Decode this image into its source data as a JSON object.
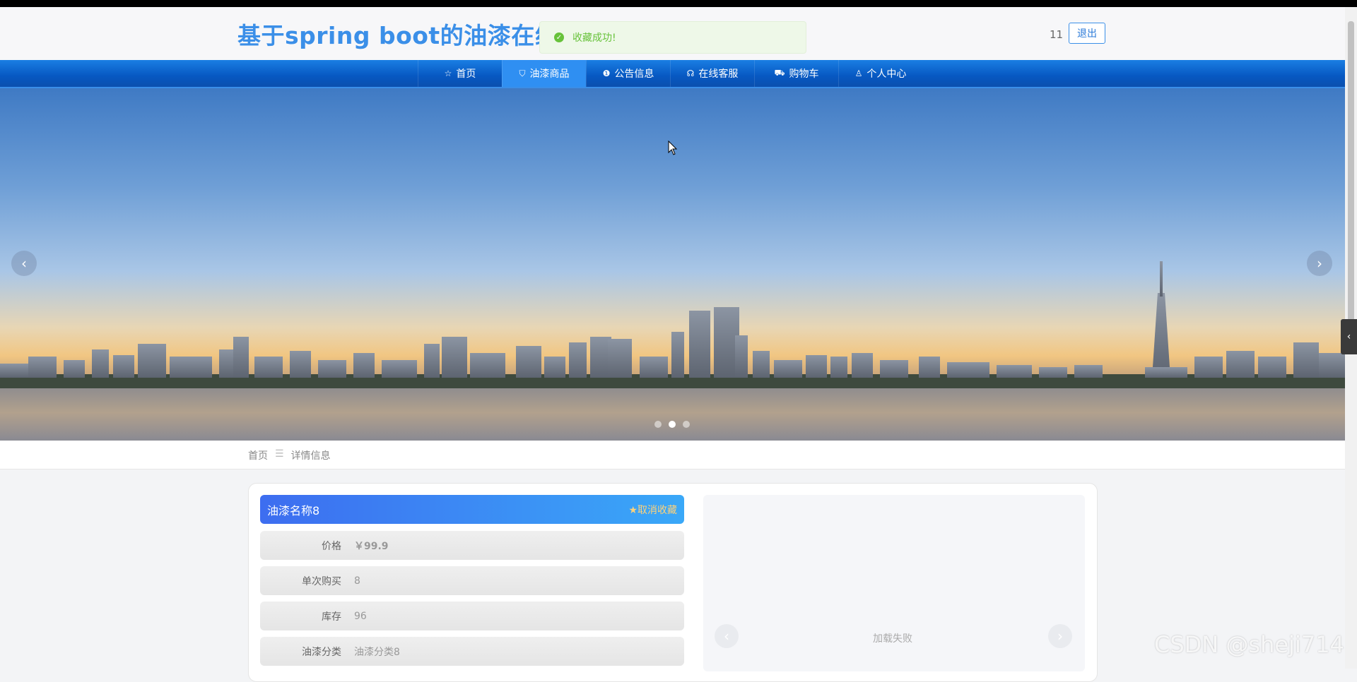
{
  "header": {
    "site_title": "基于spring boot的油漆在线商城",
    "user_count": "11",
    "logout_label": "退出"
  },
  "toast": {
    "message": "收藏成功!"
  },
  "nav": {
    "items": [
      {
        "label": "首页",
        "icon": "star-icon"
      },
      {
        "label": "油漆商品",
        "icon": "bag-icon"
      },
      {
        "label": "公告信息",
        "icon": "info-icon"
      },
      {
        "label": "在线客服",
        "icon": "headset-icon"
      },
      {
        "label": "购物车",
        "icon": "cart-icon"
      },
      {
        "label": "个人中心",
        "icon": "user-icon"
      }
    ],
    "active_index": 1
  },
  "carousel": {
    "dots": 3,
    "active": 1
  },
  "breadcrumb": {
    "home": "首页",
    "separator": "☰",
    "current": "详情信息"
  },
  "product": {
    "name": "油漆名称8",
    "favorite_label": "★取消收藏",
    "rows": [
      {
        "label": "价格",
        "value": "￥99.9"
      },
      {
        "label": "单次购买",
        "value": "8"
      },
      {
        "label": "库存",
        "value": "96"
      },
      {
        "label": "油漆分类",
        "value": "油漆分类8"
      }
    ]
  },
  "gallery": {
    "status": "加载失败"
  },
  "watermark": "CSDN @sheji714",
  "colors": {
    "primary": "#1a7ee3",
    "title": "#3b8fe8",
    "success": "#67c23a"
  }
}
